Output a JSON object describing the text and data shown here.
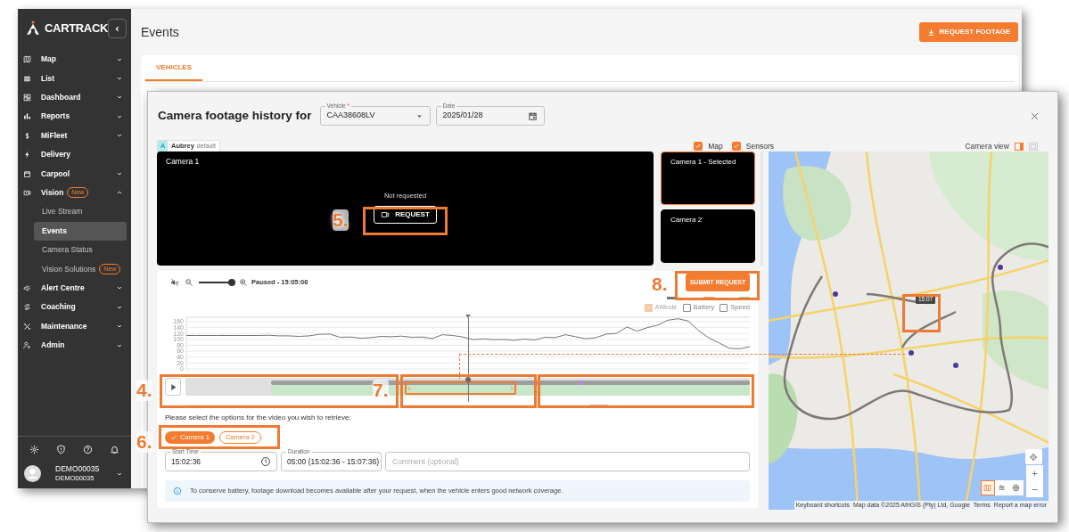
{
  "sidebar": {
    "logo": "CARTRACK",
    "items": [
      {
        "label": "Map",
        "expandable": true,
        "expanded": false,
        "selected": false
      },
      {
        "label": "List",
        "expandable": true,
        "expanded": false,
        "selected": false
      },
      {
        "label": "Dashboard",
        "expandable": true,
        "expanded": false,
        "selected": false
      },
      {
        "label": "Reports",
        "expandable": true,
        "expanded": false,
        "selected": false
      },
      {
        "label": "MiFleet",
        "expandable": true,
        "expanded": false,
        "selected": false
      },
      {
        "label": "Delivery",
        "expandable": false,
        "selected": false
      },
      {
        "label": "Carpool",
        "expandable": true,
        "expanded": false,
        "selected": false
      },
      {
        "label": "Vision",
        "badge": "New",
        "expandable": true,
        "expanded": true,
        "selected": false,
        "children": [
          {
            "label": "Live Stream",
            "selected": false
          },
          {
            "label": "Events",
            "selected": true
          },
          {
            "label": "Camera Status",
            "selected": false
          },
          {
            "label": "Vision Solutions",
            "badge": "New",
            "selected": false
          }
        ]
      },
      {
        "label": "Alert Centre",
        "expandable": true,
        "expanded": false,
        "selected": false
      },
      {
        "label": "Coaching",
        "expandable": true,
        "expanded": false,
        "selected": false
      },
      {
        "label": "Maintenance",
        "expandable": true,
        "expanded": false,
        "selected": false
      },
      {
        "label": "Admin",
        "expandable": true,
        "expanded": false,
        "selected": false
      }
    ],
    "user": {
      "name": "DEMO00035",
      "account": "DEMO00035"
    }
  },
  "page": {
    "title": "Events",
    "action": "REQUEST FOOTAGE",
    "tabs": [
      {
        "label": "VEHICLES",
        "selected": true
      }
    ]
  },
  "modal": {
    "title": "Camera footage history for",
    "vehicle": {
      "label": "Vehicle",
      "required_mark": "*",
      "value": "CAA38608LV"
    },
    "date": {
      "label": "Date",
      "value": "2025/01/28"
    },
    "driver": {
      "initial": "A",
      "name": "Aubrey",
      "tag": "default"
    },
    "toggles": [
      {
        "label": "Map",
        "checked": true
      },
      {
        "label": "Sensors",
        "checked": true
      }
    ],
    "camera_view": {
      "label": "Camera view",
      "options": [
        {
          "selected": true
        },
        {
          "selected": false
        }
      ]
    },
    "main_video": {
      "title": "Camera 1",
      "status": "Not requested",
      "button": "REQUEST"
    },
    "thumbnails": [
      {
        "title": "Camera 1 - Selected",
        "selected": true
      },
      {
        "title": "Camera 2",
        "selected": false
      }
    ],
    "player": {
      "status": "Paused - 15:05:06",
      "muted": true,
      "zoom": {
        "level": 1
      }
    },
    "submit": "SUBMIT REQUEST",
    "legend": [
      {
        "label": "Altitude",
        "checked": true,
        "color": "#757575"
      },
      {
        "label": "Battery",
        "checked": false,
        "color": "#f4a37a"
      },
      {
        "label": "Speed",
        "checked": false,
        "color": "#a5d6a7"
      }
    ],
    "chart_data": {
      "type": "line",
      "grid": true,
      "ylim": [
        0,
        175
      ],
      "yticks": [
        0,
        20,
        40,
        60,
        80,
        100,
        120,
        140,
        160
      ],
      "series": [
        {
          "color": "#757575",
          "values": [
            113,
            113,
            113,
            113,
            113,
            113,
            113,
            113,
            114,
            112,
            112,
            110,
            112,
            117,
            118,
            107,
            108,
            104,
            106,
            110,
            109,
            111,
            107,
            108,
            103,
            116,
            113,
            108,
            99,
            102,
            99,
            100,
            97,
            101,
            98,
            107,
            106,
            116,
            109,
            102,
            106,
            118,
            120,
            142,
            128,
            140,
            148,
            165,
            170,
            162,
            130,
            105,
            88,
            70,
            68,
            75
          ]
        }
      ]
    },
    "prompt": "Please select the options for the video you wish to retrieve:",
    "cameras": [
      {
        "label": "Camera 1",
        "selected": true
      },
      {
        "label": "Camera 2",
        "selected": false
      }
    ],
    "start_time": {
      "label": "Start Time",
      "value": "15:02:36"
    },
    "duration": {
      "label": "Duration",
      "value": "05:00 (15:02:36 - 15:07:36)"
    },
    "comment": {
      "placeholder": "Comment (optional)"
    },
    "info": "To conserve battery, footage download becomes available after your request, when the vehicle enters good network coverage.",
    "map": {
      "kind": "picture",
      "marker_time": "15:07",
      "map_types": [
        {
          "selected": true
        },
        {
          "selected": false
        },
        {
          "selected": false
        }
      ],
      "attribution": [
        "Keyboard shortcuts",
        "Map data ©2025 AfriGIS (Pty) Ltd, Google",
        "Terms",
        "Report a map error"
      ]
    }
  },
  "annotations": [
    {
      "label": "4."
    },
    {
      "label": "5."
    },
    {
      "label": "6."
    },
    {
      "label": "7."
    },
    {
      "label": "8."
    }
  ]
}
